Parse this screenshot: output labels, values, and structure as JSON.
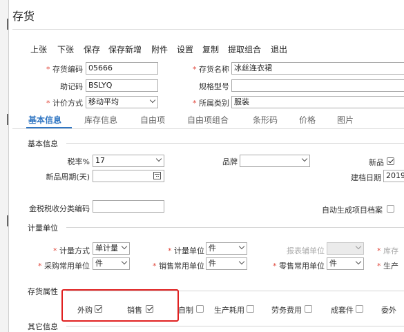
{
  "title": "存货",
  "toolbar": [
    "上张",
    "下张",
    "保存",
    "保存新增",
    "附件",
    "设置",
    "复制",
    "提取组合",
    "退出"
  ],
  "header": {
    "code": {
      "label": "存货编码",
      "value": "05666"
    },
    "name": {
      "label": "存货名称",
      "value": "冰丝连衣裙"
    },
    "mnemonic": {
      "label": "助记码",
      "value": "BSLYQ"
    },
    "spec": {
      "label": "规格型号",
      "value": ""
    },
    "pricing": {
      "label": "计价方式",
      "value": "移动平均"
    },
    "category": {
      "label": "所属类别",
      "value": "服装"
    }
  },
  "tabs": [
    "基本信息",
    "库存信息",
    "自由项",
    "自由项组合",
    "条形码",
    "价格",
    "图片"
  ],
  "basic": {
    "section": "基本信息",
    "tax_label": "税率%",
    "tax_value": "17",
    "brand_label": "品牌",
    "new_label": "新品",
    "period_label": "新品周期(天)",
    "created_label": "建档日期",
    "created_value": "2019",
    "tax_code_label": "金税税收分类编码",
    "auto_label": "自动生成项目档案"
  },
  "units": {
    "section": "计量单位",
    "method_label": "计量方式",
    "method_value": "单计量",
    "unit_label": "计量单位",
    "unit_value": "件",
    "report_label": "报表辅单位",
    "stock_label": "库存",
    "purchase_label": "采购常用单位",
    "purchase_value": "件",
    "sales_label": "销售常用单位",
    "sales_value": "件",
    "retail_label": "零售常用单位",
    "retail_value": "件",
    "prod_label": "生产"
  },
  "attrs": {
    "section": "存货属性",
    "items": [
      {
        "label": "外购",
        "checked": true
      },
      {
        "label": "销售",
        "checked": true
      },
      {
        "label": "自制",
        "checked": false
      },
      {
        "label": "生产耗用",
        "checked": false
      },
      {
        "label": "劳务费用",
        "checked": false
      },
      {
        "label": "成套件",
        "checked": false
      },
      {
        "label": "委外",
        "checked": false
      }
    ]
  },
  "other": {
    "section": "其它信息"
  }
}
